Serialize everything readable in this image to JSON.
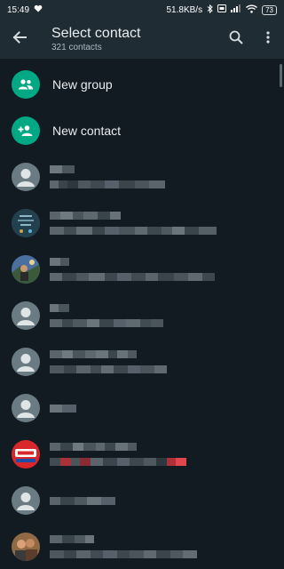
{
  "status_bar": {
    "time": "15:49",
    "network_speed": "51.8KB/s",
    "battery": "73"
  },
  "app_bar": {
    "title": "Select contact",
    "subtitle": "321 contacts",
    "back_icon": "arrow-back-icon",
    "search_icon": "search-icon",
    "menu_icon": "more-vert-icon"
  },
  "actions": [
    {
      "label": "New group",
      "icon": "group-icon"
    },
    {
      "label": "New contact",
      "icon": "add-person-icon"
    }
  ],
  "colors": {
    "background": "#121b22",
    "app_bar": "#1f2c34",
    "accent": "#00a884",
    "avatar_default": "#6b7b83"
  },
  "contacts_note": "contact names and statuses are pixelated/blurred in the screenshot"
}
